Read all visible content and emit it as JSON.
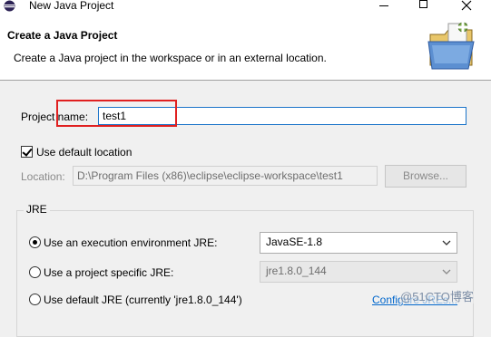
{
  "window": {
    "title": "New Java Project",
    "controls": {
      "minimize": "minimize-icon",
      "maximize": "maximize-icon",
      "close": "close-icon"
    }
  },
  "banner": {
    "title": "Create a Java Project",
    "description": "Create a Java project in the workspace or in an external location.",
    "graphic": "new-java-project-folder-icon"
  },
  "form": {
    "project_name_label": "Project name:",
    "project_name_value": "test1",
    "use_default_location_label": "Use default location",
    "use_default_location_checked": true,
    "location_label": "Location:",
    "location_value": "D:\\Program Files (x86)\\eclipse\\eclipse-workspace\\test1",
    "browse_label": "Browse..."
  },
  "jre": {
    "group_label": "JRE",
    "options": [
      {
        "label": "Use an execution environment JRE:",
        "selected": true,
        "combo_value": "JavaSE-1.8"
      },
      {
        "label": "Use a project specific JRE:",
        "selected": false,
        "combo_value": "jre1.8.0_144"
      },
      {
        "label": "Use default JRE (currently 'jre1.8.0_144')",
        "selected": false
      }
    ],
    "configure_link": "Configure JREs..."
  },
  "overlay": {
    "watermark": "@51CTO博客",
    "highlight_color": "#e02020"
  },
  "colors": {
    "accent": "#1b74c9",
    "link": "#0066cc"
  }
}
